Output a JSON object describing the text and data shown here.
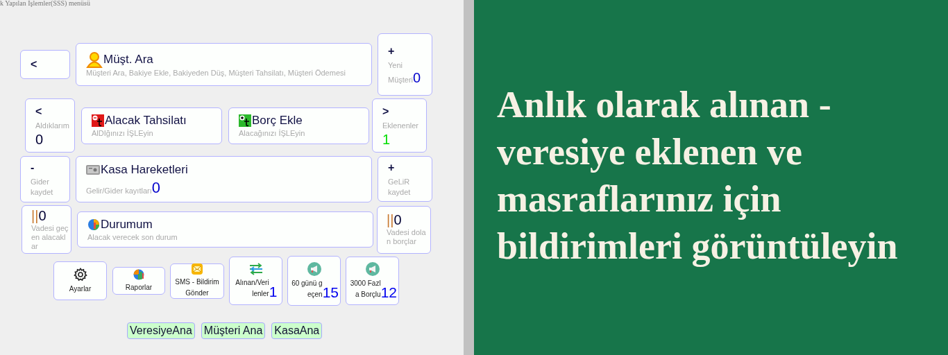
{
  "header": {
    "text": "k Yapılan İşlemler(SSS) menüsü"
  },
  "rows": [
    [
      {
        "kind": "nav",
        "symbol": "<"
      },
      {
        "kind": "main",
        "title": "Müşt. Ara",
        "subtitle": "Müşteri Ara, Bakiye Ekle, Bakiyeden Düş, Müşteri Tahsilatı, Müşteri Ödemesi"
      },
      {
        "kind": "nav",
        "symbol": "+",
        "label": "Yeni Müşteri",
        "count": "0",
        "color": "#0000cc"
      }
    ],
    [
      {
        "kind": "nav",
        "symbol": "<",
        "label": "Aldıklarım",
        "count": "0",
        "color": "#000033"
      },
      {
        "kind": "main",
        "title": "Alacak Tahsilatı",
        "subtitle": "AlDIğınızı İŞLEyin"
      },
      {
        "kind": "main",
        "title": "Borç Ekle",
        "subtitle": "Alacağınızı İŞLEyin"
      },
      {
        "kind": "nav",
        "symbol": ">",
        "label": "Eklenenler",
        "count": "1",
        "color": "#00dd00"
      }
    ],
    [
      {
        "kind": "nav",
        "symbol": "-",
        "label": "Gider kaydet"
      },
      {
        "kind": "main",
        "title": "Kasa Hareketleri",
        "subtitle": "Gelir/Gider kayıtları",
        "count": "0",
        "color": "#0000cc"
      },
      {
        "kind": "nav",
        "symbol": "+",
        "label": "GeLiR kaydet"
      }
    ],
    [
      {
        "kind": "due",
        "symbol": "||",
        "count": "0",
        "label": "Vadesi geçen alacaklar",
        "color": "#000033"
      },
      {
        "kind": "main",
        "title": "Durumum",
        "subtitle": "Alacak verecek son durum"
      },
      {
        "kind": "due",
        "symbol": "||",
        "count": "0",
        "label": "Vadesi dolan borçlar",
        "color": "#000033"
      }
    ],
    [
      {
        "kind": "tool",
        "label": "Ayarlar"
      },
      {
        "kind": "tool",
        "label": "Raporlar"
      },
      {
        "kind": "tool",
        "label": "SMS - Bildirim Gönder"
      },
      {
        "kind": "tool",
        "label": "Alınan/Verilenler",
        "count": "1",
        "color": "#0000ee"
      },
      {
        "kind": "tool",
        "label": "60 günü geçen",
        "count": "15",
        "color": "#0000ee"
      },
      {
        "kind": "tool",
        "label": "3000 Fazla Borçlu",
        "count": "12",
        "color": "#0000ee"
      }
    ]
  ],
  "bottom_buttons": [
    {
      "label": "VeresiyeAna"
    },
    {
      "label": "Müşteri Ana"
    },
    {
      "label": "KasaAna"
    }
  ],
  "promo": {
    "headline": "Anlık olarak alınan - veresiye eklenen ve masraflarınız için bildirimleri görüntüleyin"
  }
}
